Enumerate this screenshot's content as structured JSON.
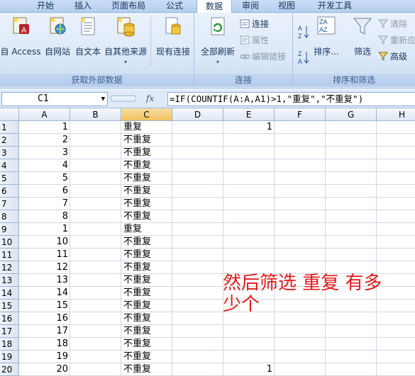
{
  "tabs": [
    "开始",
    "插入",
    "页面布局",
    "公式",
    "数据",
    "审阅",
    "视图",
    "开发工具"
  ],
  "active_tab": "数据",
  "ribbon": {
    "external_data": {
      "label": "获取外部数据",
      "buttons": [
        "自 Access",
        "自网站",
        "自文本",
        "自其他来源",
        "现有连接"
      ]
    },
    "connections": {
      "label": "连接",
      "refresh_all": "全部刷新",
      "connections_btn": "连接",
      "properties_btn": "属性",
      "edit_links_btn": "编辑链接"
    },
    "sort_filter": {
      "label": "排序和筛选",
      "sort": "排序...",
      "filter": "筛选",
      "clear": "清除",
      "reapply": "重新应",
      "advanced": "高级"
    }
  },
  "formula_bar": {
    "name_box": "C1",
    "fx": "fx",
    "formula": "=IF(COUNTIF(A:A,A1)>1,\"重复\",\"不重复\")"
  },
  "sheet": {
    "columns": [
      "A",
      "B",
      "C",
      "D",
      "E",
      "F",
      "G",
      "H"
    ],
    "selected_column": "C",
    "rows": [
      {
        "n": "1",
        "a": "1",
        "c": "重复",
        "e": "1"
      },
      {
        "n": "2",
        "a": "2",
        "c": "不重复",
        "e": ""
      },
      {
        "n": "3",
        "a": "3",
        "c": "不重复",
        "e": ""
      },
      {
        "n": "4",
        "a": "4",
        "c": "不重复",
        "e": ""
      },
      {
        "n": "5",
        "a": "5",
        "c": "不重复",
        "e": ""
      },
      {
        "n": "6",
        "a": "6",
        "c": "不重复",
        "e": ""
      },
      {
        "n": "7",
        "a": "7",
        "c": "不重复",
        "e": ""
      },
      {
        "n": "8",
        "a": "8",
        "c": "不重复",
        "e": ""
      },
      {
        "n": "9",
        "a": "1",
        "c": "重复",
        "e": ""
      },
      {
        "n": "10",
        "a": "10",
        "c": "不重复",
        "e": ""
      },
      {
        "n": "11",
        "a": "11",
        "c": "不重复",
        "e": ""
      },
      {
        "n": "12",
        "a": "12",
        "c": "不重复",
        "e": ""
      },
      {
        "n": "13",
        "a": "13",
        "c": "不重复",
        "e": ""
      },
      {
        "n": "14",
        "a": "14",
        "c": "不重复",
        "e": ""
      },
      {
        "n": "15",
        "a": "15",
        "c": "不重复",
        "e": ""
      },
      {
        "n": "16",
        "a": "16",
        "c": "不重复",
        "e": ""
      },
      {
        "n": "17",
        "a": "17",
        "c": "不重复",
        "e": ""
      },
      {
        "n": "18",
        "a": "18",
        "c": "不重复",
        "e": ""
      },
      {
        "n": "19",
        "a": "19",
        "c": "不重复",
        "e": ""
      },
      {
        "n": "20",
        "a": "20",
        "c": "不重复",
        "e": "1"
      }
    ]
  },
  "annotation": "然后筛选 重复 有多少个",
  "colors": {
    "annotation": "#e31a1c",
    "ribbon_text": "#15345b"
  }
}
